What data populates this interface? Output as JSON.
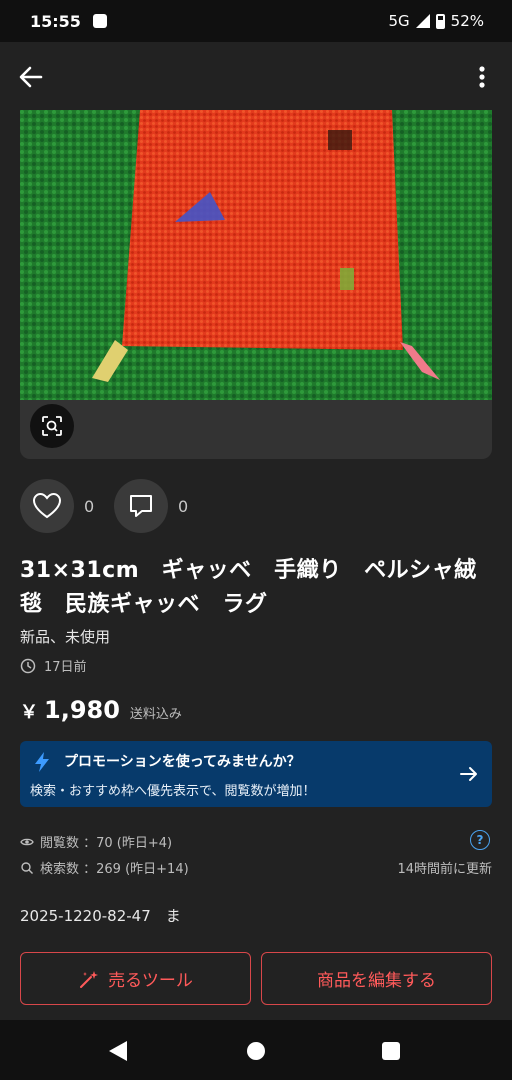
{
  "status_bar": {
    "time": "15:55",
    "network": "5G",
    "battery": "52%"
  },
  "header": {
    "back_icon": "arrow-left-icon",
    "more_icon": "more-vert-icon"
  },
  "image": {
    "description_icon": "image-search-icon"
  },
  "actions": {
    "likes": "0",
    "comments": "0"
  },
  "product": {
    "title": "31×31cm　ギャッベ　手織り　ペルシャ絨毯　民族ギャッベ　ラグ",
    "condition": "新品、未使用",
    "posted": "17日前",
    "price_symbol": "￥",
    "price": "1,980",
    "shipping": "送料込み"
  },
  "promo": {
    "title": "プロモーションを使ってみませんか？",
    "body": "検索・おすすめ枠へ優先表示で、閲覧数が増加！"
  },
  "stats": {
    "views": "閲覧数 ：70 (昨日+4)",
    "searches": "検索数 ：269 (昨日+14)",
    "help": "?",
    "updated": "14時間前に更新"
  },
  "product_code": "2025-1220-82-47　ま",
  "buttons": {
    "sell_tool": "売るツール",
    "edit": "商品を編集する"
  },
  "colors": {
    "accent": "#ff5a5a",
    "promo_bg": "#073a6b",
    "background": "#222222"
  }
}
